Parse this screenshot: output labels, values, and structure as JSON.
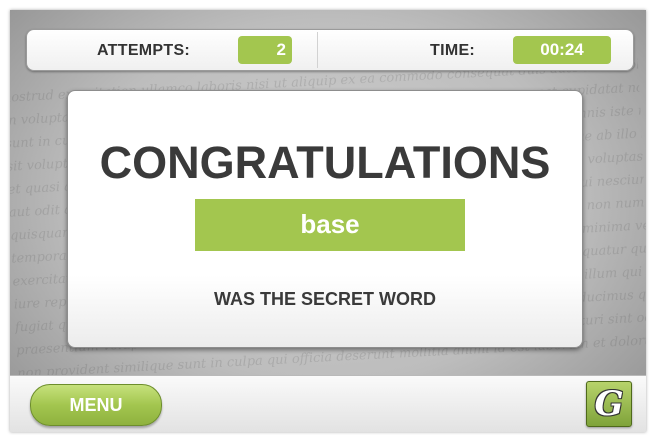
{
  "status_bar": {
    "attempts_label": "ATTEMPTS:",
    "attempts_value": "2",
    "time_label": "TIME:",
    "time_value": "00:24"
  },
  "result": {
    "title": "CONGRATULATIONS",
    "secret_word": "base",
    "caption": "WAS THE SECRET WORD"
  },
  "bottom_bar": {
    "menu_label": "MENU",
    "logo_icon": "g-logo-icon"
  },
  "colors": {
    "accent_green": "#a3c64f",
    "text_dark": "#3a3a3a",
    "background_gray": "#bdbdbd"
  }
}
